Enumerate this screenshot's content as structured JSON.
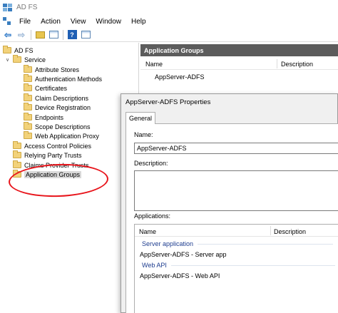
{
  "window": {
    "title": "AD FS"
  },
  "menu": {
    "items": [
      "File",
      "Action",
      "View",
      "Window",
      "Help"
    ]
  },
  "toolbar": {
    "icons": [
      "back-arrow-icon",
      "forward-arrow-icon",
      "up-folder-icon",
      "show-hide-console-tree-icon",
      "help-icon",
      "action-pane-icon"
    ]
  },
  "tree": {
    "root": "AD FS",
    "service": "Service",
    "service_children": [
      "Attribute Stores",
      "Authentication Methods",
      "Certificates",
      "Claim Descriptions",
      "Device Registration",
      "Endpoints",
      "Scope Descriptions",
      "Web Application Proxy"
    ],
    "access_control": "Access Control Policies",
    "relying_party": "Relying Party Trusts",
    "claims_provider": "Claims Provider Trusts",
    "application_groups": "Application Groups"
  },
  "right_pane": {
    "header": "Application Groups",
    "columns": [
      "Name",
      "Description"
    ],
    "rows": [
      {
        "name": "AppServer-ADFS",
        "description": ""
      }
    ]
  },
  "dialog": {
    "title": "AppServer-ADFS Properties",
    "tab": "General",
    "name_label": "Name:",
    "name_value": "AppServer-ADFS",
    "description_label": "Description:",
    "description_value": "",
    "applications_label": "Applications:",
    "app_columns": [
      "Name",
      "Description"
    ],
    "groups": [
      {
        "header": "Server application",
        "item": "AppServer-ADFS - Server app"
      },
      {
        "header": "Web API",
        "item": "AppServer-ADFS - Web API"
      }
    ]
  },
  "annotation": {
    "color": "#e8141b"
  }
}
